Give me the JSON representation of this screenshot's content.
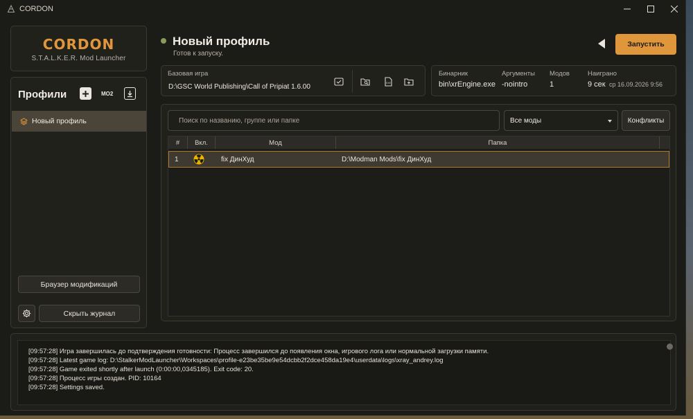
{
  "window": {
    "title": "CORDON"
  },
  "brand": {
    "name": "CORDON",
    "subtitle": "S.T.A.L.K.E.R. Mod Launcher"
  },
  "sidebar": {
    "title": "Профили",
    "mo2_label": "MO2",
    "profiles": [
      {
        "label": "Новый профиль",
        "icon": "layers-icon",
        "selected": true
      }
    ],
    "browser_button": "Браузер модификаций",
    "hide_log_button": "Скрыть журнал"
  },
  "header": {
    "profile_name": "Новый профиль",
    "status": "Готов к запуску.",
    "status_color": "#8a9a5a",
    "launch_button": "Запустить",
    "accent_color": "#e0963a"
  },
  "base_game": {
    "label": "Базовая игра",
    "path": "D:\\GSC World Publishing\\Call of Pripiat 1.6.00"
  },
  "info": {
    "binary_label": "Бинарник",
    "binary_value": "bin\\xrEngine.exe",
    "args_label": "Аргументы",
    "args_value": "-nointro",
    "mods_label": "Модов",
    "mods_value": "1",
    "played_label": "Наиграно",
    "played_value": "9 сек",
    "played_date": "ср 16.09.2026 9:56"
  },
  "mods": {
    "search_placeholder": "Поиск по названию, группе или папке",
    "filter_value": "Все моды",
    "conflicts_button": "Конфликты",
    "columns": [
      "#",
      "Вкл.",
      "Мод",
      "Папка"
    ],
    "rows": [
      {
        "num": "1",
        "enabled_icon": "radiation-icon",
        "name": "fix ДинХуд",
        "folder": "D:\\Modman Mods\\fix ДинХуд"
      }
    ]
  },
  "log": {
    "lines": [
      "[09:57:28] Игра завершилась до подтверждения готовности: Процесс завершился до появления окна, игрового лога или нормальной загрузки памяти.",
      "[09:57:28] Latest game log: D:\\StalkerModLauncher\\Workspaces\\profile-e23be35be9e54dcbb2f2dce458da19e4\\userdata\\logs\\xray_andrey.log",
      "[09:57:28] Game exited shortly after launch (0:00:00,0345185). Exit code: 20.",
      "[09:57:28] Процесс игры создан. PID: 10164",
      "[09:57:28] Settings saved."
    ]
  }
}
